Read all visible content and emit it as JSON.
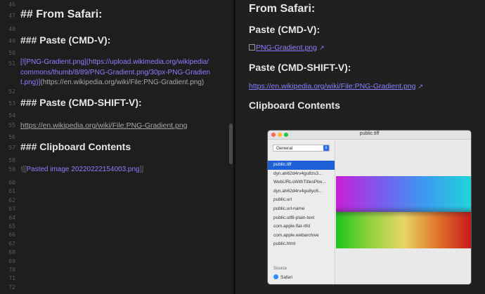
{
  "editor": {
    "lines": [
      {
        "n": "46",
        "top": 0
      },
      {
        "n": "47",
        "text": "## From Safari:"
      },
      {
        "n": "48"
      },
      {
        "n": "49",
        "text": "### Paste (CMD-V):"
      },
      {
        "n": "50"
      },
      {
        "n": "51",
        "link_text": "[![PNG-Gradient.png](https://upload.wikimedia.org/wikipedia/commons/thumb/8/89/PNG-Gradient.png/30px-PNG-Gradient.png)]",
        "link_url": "(https://en.wikipedia.org/wiki/File:PNG-Gradient.png)"
      },
      {
        "n": "52"
      },
      {
        "n": "53",
        "text": "### Paste (CMD-SHIFT-V):"
      },
      {
        "n": "54"
      },
      {
        "n": "55",
        "text": "https://en.wikipedia.org/wiki/File:PNG-Gradient.png"
      },
      {
        "n": "56"
      },
      {
        "n": "57",
        "text": "### Clipboard Contents"
      },
      {
        "n": "58"
      },
      {
        "n": "59",
        "text": "![[Pasted image 20220222154003.png]]"
      }
    ],
    "line_numbers_extra": [
      "60",
      "61",
      "62",
      "63",
      "64",
      "65",
      "66",
      "67",
      "68",
      "69",
      "70",
      "71",
      "72"
    ],
    "line_51_part1": "[![PNG-Gradient.png](https://upload.wikimedia.org/wikipedia/",
    "line_51_part2": "commons/thumb/8/89/PNG-Gradient.png/30px-PNG-Gradien",
    "line_51_part3": "t.png)]",
    "line_51_url": "(https://en.wikipedia.org/wiki/File:PNG-Gradient.png)",
    "embed_open": "![[",
    "embed_name": "Pasted image 20220222154003.png",
    "embed_close": "]]"
  },
  "preview": {
    "title": "From Safari:",
    "heading_paste": "Paste (CMD-V):",
    "image_link": "PNG-Gradient.png",
    "heading_paste_shift": "Paste (CMD-SHIFT-V):",
    "url_link": "https://en.wikipedia.org/wiki/File:PNG-Gradient.png",
    "heading_clipboard": "Clipboard Contents",
    "external_icon": "external-link-icon"
  },
  "clipboard_window": {
    "title": "public.tiff",
    "select_value": "General",
    "types": [
      "public.tiff",
      "dyn.ah62d4rv4gu8zs3...",
      "WebURLsWithTitlesPbo...",
      "dyn.ah62d4rv4gu8yc6...",
      "public.url",
      "public.url-name",
      "public.utf8-plain-text",
      "com.apple.flat-rtfd",
      "com.apple.webarchive",
      "public.html"
    ],
    "selected_index": 0,
    "source_label": "Source",
    "source_app": "Safari",
    "colors": {
      "close": "#fe5f57",
      "minimize": "#febc2e",
      "zoom": "#28c840",
      "selection": "#1e5fd8"
    }
  }
}
